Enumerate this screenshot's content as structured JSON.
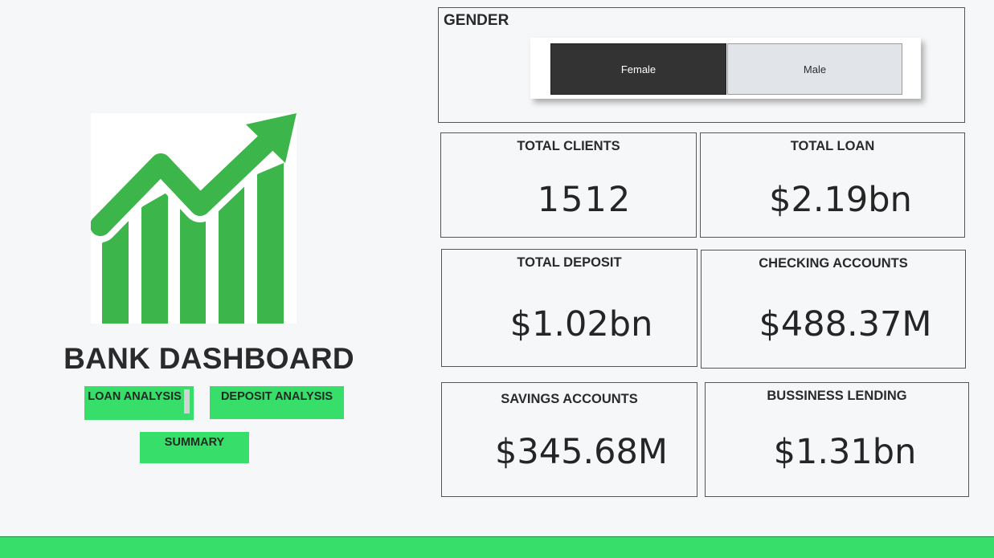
{
  "dashboard": {
    "title": "BANK DASHBOARD"
  },
  "nav": {
    "loan_analysis": "LOAN ANALYSIS",
    "deposit_analysis": "DEPOSIT ANALYSIS",
    "summary": "SUMMARY"
  },
  "gender": {
    "title": "GENDER",
    "options": [
      "Female",
      "Male"
    ],
    "selected": "Female"
  },
  "kpis": {
    "total_clients": {
      "label": "TOTAL CLIENTS",
      "value": "1512"
    },
    "total_loan": {
      "label": "TOTAL LOAN",
      "value": "$2.19bn"
    },
    "total_deposit": {
      "label": "TOTAL DEPOSIT",
      "value": "$1.02bn"
    },
    "checking_accounts": {
      "label": "CHECKING ACCOUNTS",
      "value": "$488.37M"
    },
    "savings_accounts": {
      "label": "SAVINGS ACCOUNTS",
      "value": "$345.68M"
    },
    "business_lending": {
      "label": "BUSSINESS LENDING",
      "value": "$1.31bn"
    }
  },
  "colors": {
    "accent_green": "#37de69",
    "logo_green": "#3cb54a",
    "dark": "#333333"
  },
  "icons": {
    "logo": "growth-chart-icon"
  }
}
